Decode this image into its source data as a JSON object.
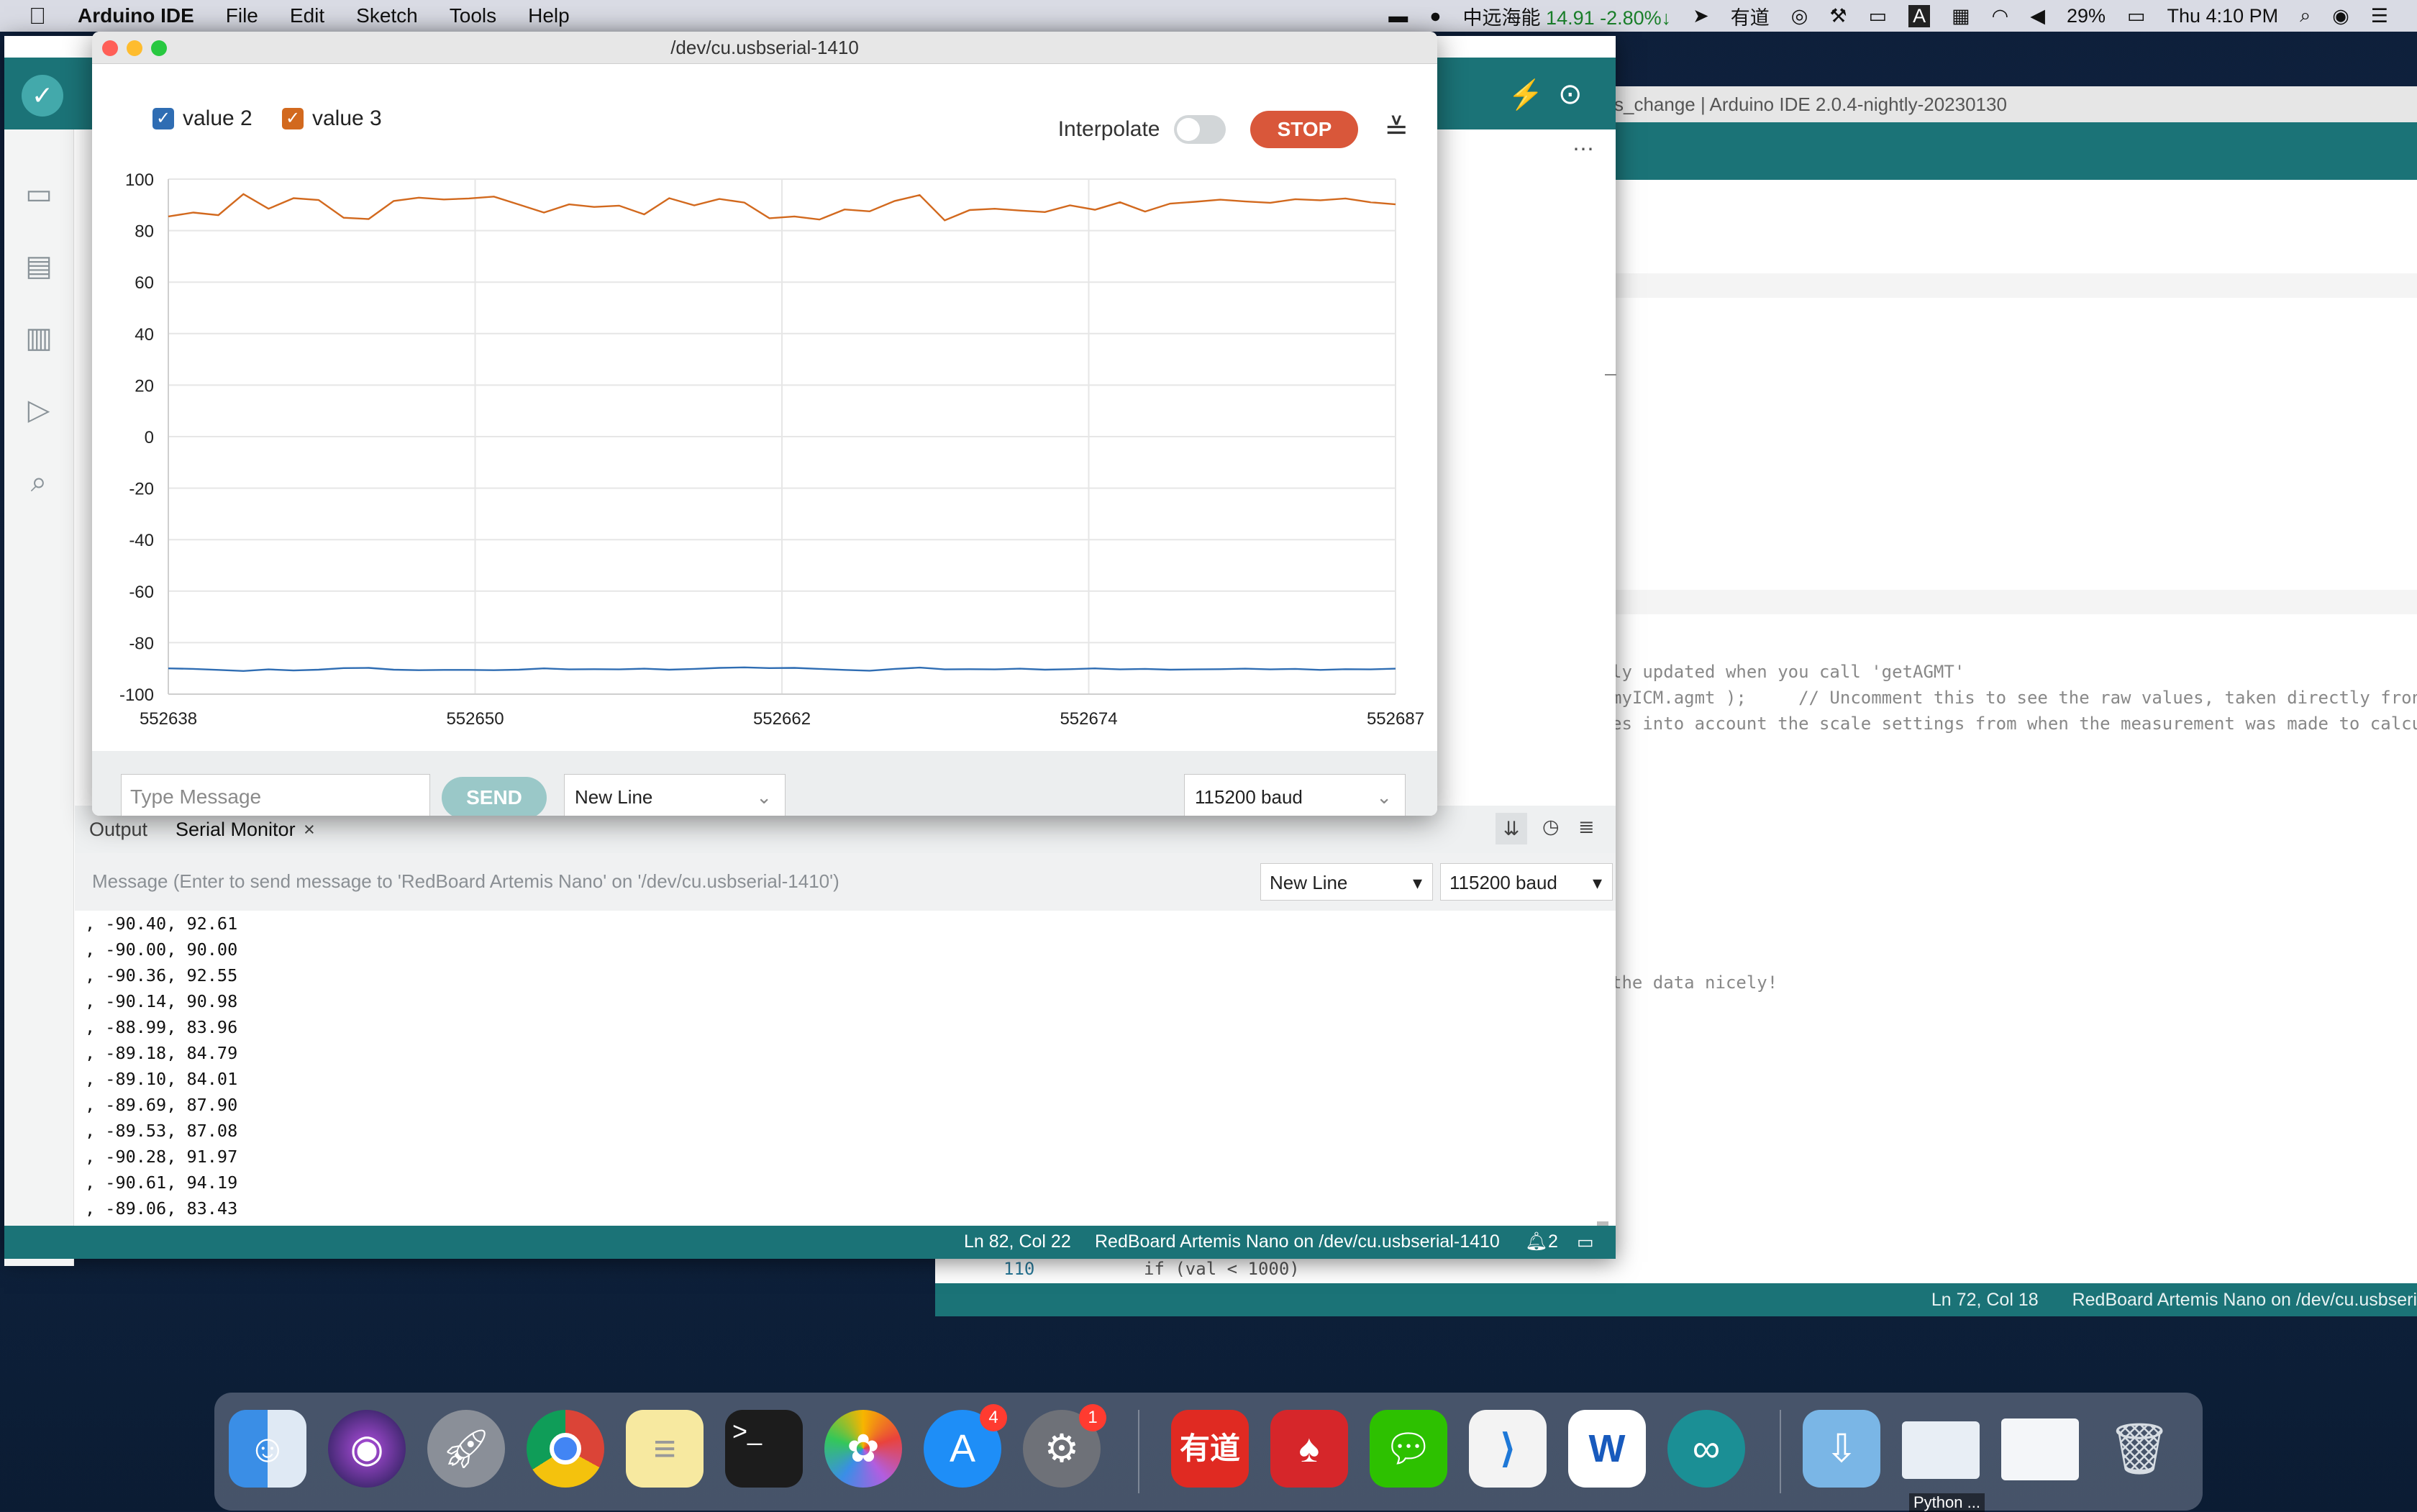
{
  "menubar": {
    "app_name": "Arduino IDE",
    "menus": [
      "File",
      "Edit",
      "Sketch",
      "Tools",
      "Help"
    ],
    "stock_label": "中远海能",
    "stock_value": "14.91 -2.80%↓",
    "youdao": "有道",
    "battery": "29%",
    "clock": "Thu 4:10 PM"
  },
  "back_window": {
    "title": "s_change | Arduino IDE 2.0.4-nightly-20230130",
    "code_lines": [
      "ly updated when you call 'getAGMT'",
      "myICM.agmt );     // Uncomment this to see the raw values, taken directly fron",
      "es into account the scale settings from when the measurement was made to calcu",
      "the data nicely!"
    ],
    "line_number": "110",
    "line_code": "if (val < 1000)",
    "status_position": "Ln 72, Col 18",
    "status_board": "RedBoard Artemis Nano on /dev/cu.usbseri"
  },
  "plotter": {
    "title": "/dev/cu.usbserial-1410",
    "legend": [
      {
        "label": "value 2",
        "color": "#2f6db3"
      },
      {
        "label": "value 3",
        "color": "#d2691e"
      }
    ],
    "interpolate_label": "Interpolate",
    "stop_label": "STOP",
    "message_placeholder": "Type Message",
    "send_label": "SEND",
    "line_ending": "New Line",
    "baud": "115200 baud"
  },
  "chart_data": {
    "type": "line",
    "ylim": [
      -100,
      100
    ],
    "yticks": [
      "100",
      "80",
      "60",
      "40",
      "20",
      "0",
      "-20",
      "-40",
      "-60",
      "-80",
      "-100"
    ],
    "xticks": [
      "552638",
      "552650",
      "552662",
      "552674",
      "552687"
    ],
    "xlim": [
      552638,
      552687
    ],
    "grid": true,
    "series": [
      {
        "name": "value 2",
        "color": "#2f6db3",
        "values": [
          -90.0,
          -90.2,
          -90.6,
          -91.0,
          -90.4,
          -90.8,
          -90.5,
          -89.9,
          -89.8,
          -90.5,
          -90.7,
          -90.6,
          -90.6,
          -90.7,
          -90.5,
          -90.0,
          -90.4,
          -90.3,
          -90.4,
          -90.1,
          -90.5,
          -90.2,
          -89.8,
          -89.6,
          -89.9,
          -89.8,
          -90.2,
          -90.6,
          -90.9,
          -90.2,
          -89.7,
          -90.4,
          -90.3,
          -90.4,
          -90.1,
          -90.5,
          -90.3,
          -90.0,
          -90.4,
          -90.2,
          -90.5,
          -90.4,
          -90.3,
          -90.1,
          -90.4,
          -90.2,
          -90.6,
          -90.3,
          -90.4,
          -90.1
        ]
      },
      {
        "name": "value 3",
        "color": "#d2691e",
        "values": [
          85.5,
          87.0,
          86.0,
          94.2,
          88.5,
          92.6,
          91.9,
          85.0,
          84.5,
          91.5,
          92.8,
          92.1,
          92.5,
          93.2,
          90.1,
          87.0,
          90.2,
          89.2,
          89.7,
          86.3,
          92.6,
          89.8,
          92.3,
          90.9,
          84.8,
          85.5,
          84.3,
          88.2,
          87.5,
          91.5,
          93.8,
          84.0,
          88.0,
          88.5,
          87.8,
          87.2,
          89.8,
          88.1,
          91.0,
          87.4,
          90.5,
          91.2,
          92.0,
          91.3,
          90.8,
          92.2,
          91.8,
          92.5,
          91.0,
          90.2
        ]
      }
    ]
  },
  "serial_panel": {
    "tab_output": "Output",
    "tab_serial": "Serial Monitor",
    "tab_close": "×",
    "message_placeholder": "Message (Enter to send message to 'RedBoard Artemis Nano' on '/dev/cu.usbserial-1410')",
    "line_ending": "New Line",
    "baud": "115200 baud",
    "lines": [
      ", -90.40, 92.61",
      ", -90.00, 90.00",
      ", -90.36, 92.55",
      ", -90.14, 90.98",
      ", -88.99, 83.96",
      ", -89.18, 84.79",
      ", -89.10, 84.01",
      ", -89.69, 87.90",
      ", -89.53, 87.08",
      ", -90.28, 91.97",
      ", -90.61, 94.19",
      ", -89.06, 83.43"
    ]
  },
  "statusbar": {
    "position": "Ln 82, Col 22",
    "board": "RedBoard Artemis Nano on /dev/cu.usbserial-1410",
    "notifications": "2"
  },
  "dock": {
    "app_store_badge": "4",
    "settings_badge": "1",
    "youdao": "有道",
    "python_label": "Python ..."
  }
}
